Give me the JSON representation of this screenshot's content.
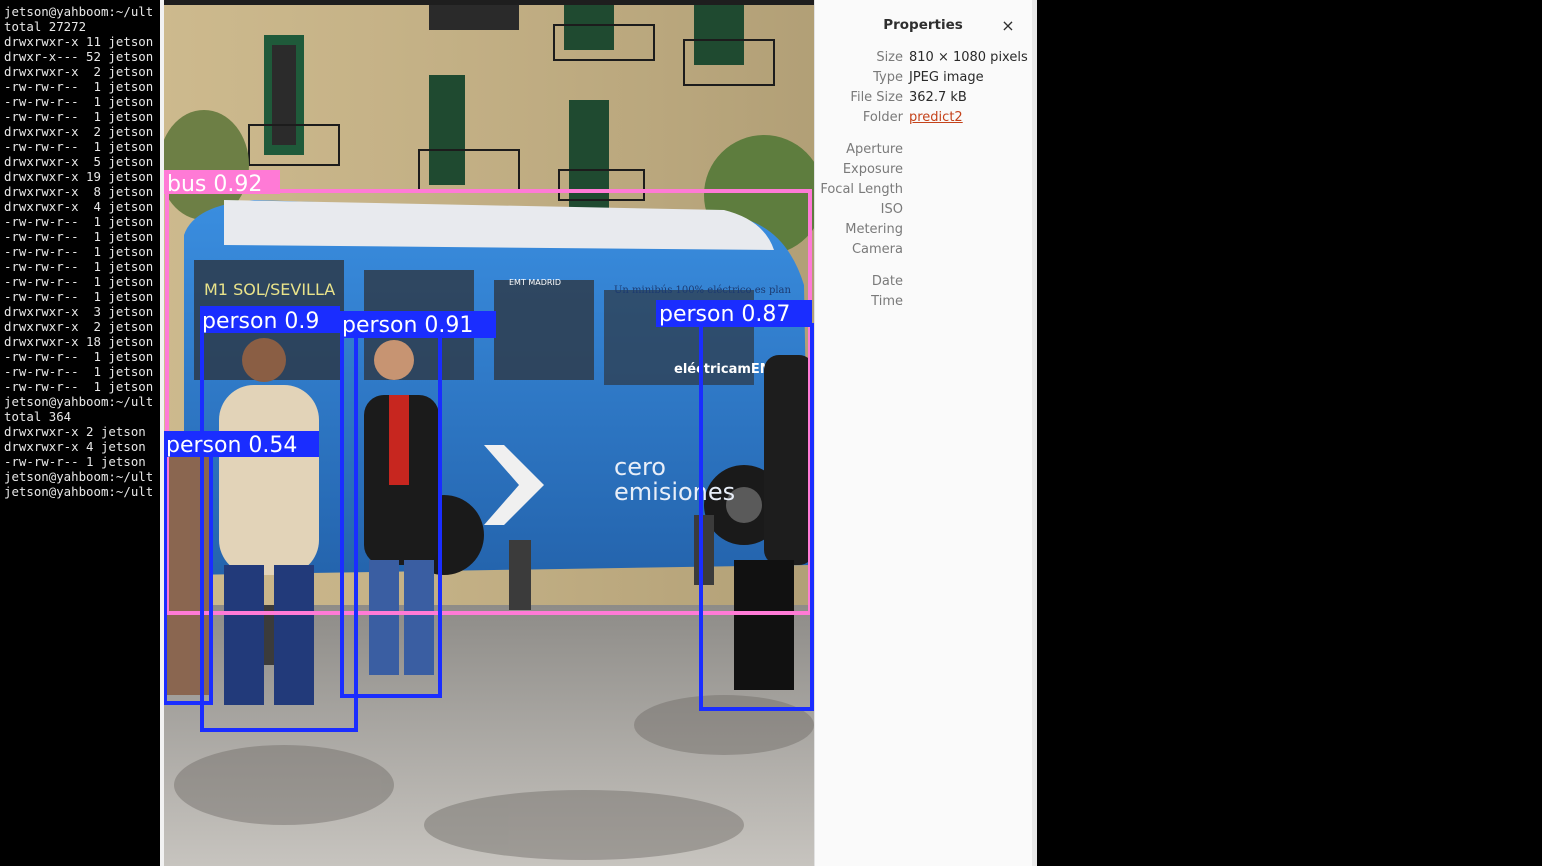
{
  "terminal": {
    "lines": [
      "jetson@yahboom:~/ult",
      "total 27272",
      "drwxrwxr-x 11 jetson",
      "drwxr-x--- 52 jetson",
      "drwxrwxr-x  2 jetson",
      "-rw-rw-r--  1 jetson",
      "-rw-rw-r--  1 jetson",
      "-rw-rw-r--  1 jetson",
      "drwxrwxr-x  2 jetson",
      "-rw-rw-r--  1 jetson",
      "drwxrwxr-x  5 jetson",
      "drwxrwxr-x 19 jetson",
      "drwxrwxr-x  8 jetson",
      "drwxrwxr-x  4 jetson",
      "-rw-rw-r--  1 jetson",
      "-rw-rw-r--  1 jetson",
      "-rw-rw-r--  1 jetson",
      "-rw-rw-r--  1 jetson",
      "-rw-rw-r--  1 jetson",
      "-rw-rw-r--  1 jetson",
      "drwxrwxr-x  3 jetson",
      "drwxrwxr-x  2 jetson",
      "drwxrwxr-x 18 jetson",
      "-rw-rw-r--  1 jetson",
      "-rw-rw-r--  1 jetson",
      "-rw-rw-r--  1 jetson",
      "jetson@yahboom:~/ult",
      "total 364",
      "drwxrwxr-x 2 jetson",
      "drwxrwxr-x 4 jetson",
      "-rw-rw-r-- 1 jetson",
      "jetson@yahboom:~/ult",
      "jetson@yahboom:~/ult"
    ]
  },
  "image": {
    "detections": [
      {
        "label": "bus 0.92",
        "class": "bus",
        "color": "#ff7ad6"
      },
      {
        "label": "person 0.9",
        "class": "person",
        "color": "#1a2dff"
      },
      {
        "label": "person 0.91",
        "class": "person",
        "color": "#1a2dff"
      },
      {
        "label": "person 0.87",
        "class": "person",
        "color": "#1a2dff"
      },
      {
        "label": "person 0.54",
        "class": "person",
        "color": "#1a2dff"
      }
    ],
    "scene_text": {
      "route": "M1 SOL/SEVILLA",
      "operator": "EMT MADRID",
      "slogan": "Un minibús 100% eléctrico es plan",
      "brand": "eléctricamEMTe",
      "tagline_1": "cero",
      "tagline_2": "emisiones"
    }
  },
  "properties": {
    "title": "Properties",
    "close_glyph": "×",
    "rows": [
      {
        "key": "Size",
        "value": "810 × 1080 pixels"
      },
      {
        "key": "Type",
        "value": "JPEG image"
      },
      {
        "key": "File Size",
        "value": "362.7 kB"
      },
      {
        "key": "Folder",
        "value": "predict2"
      },
      {
        "key": "Aperture",
        "value": ""
      },
      {
        "key": "Exposure",
        "value": ""
      },
      {
        "key": "Focal Length",
        "value": ""
      },
      {
        "key": "ISO",
        "value": ""
      },
      {
        "key": "Metering",
        "value": ""
      },
      {
        "key": "Camera",
        "value": ""
      },
      {
        "key": "Date",
        "value": ""
      },
      {
        "key": "Time",
        "value": ""
      }
    ]
  },
  "colors": {
    "link": "#c4421a",
    "bus_box": "#ff7ad6",
    "person_box": "#1a2dff",
    "bus_body": "#2f7fd1"
  }
}
